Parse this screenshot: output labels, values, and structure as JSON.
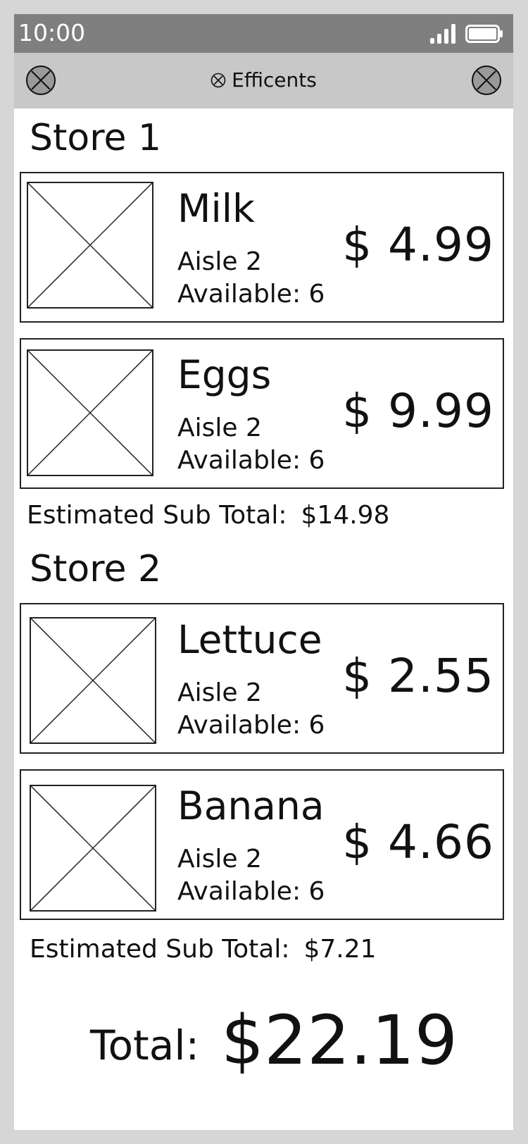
{
  "status_bar": {
    "time": "10:00",
    "signal_icon": "cellular-signal-icon",
    "battery_icon": "battery-full-icon"
  },
  "app_bar": {
    "left_icon": "close-circle-icon",
    "title_icon": "close-circle-icon",
    "title": "Efficents",
    "right_icon": "close-circle-icon"
  },
  "stores": [
    {
      "name": "Store 1",
      "items": [
        {
          "name": "Milk",
          "aisle": "Aisle 2",
          "available": "Available: 6",
          "price": "$ 4.99",
          "image_icon": "image-placeholder-icon"
        },
        {
          "name": "Eggs",
          "aisle": "Aisle 2",
          "available": "Available: 6",
          "price": "$ 9.99",
          "image_icon": "image-placeholder-icon"
        }
      ],
      "subtotal_label": "Estimated Sub Total:",
      "subtotal_value": "$14.98"
    },
    {
      "name": "Store 2",
      "items": [
        {
          "name": "Lettuce",
          "aisle": "Aisle 2",
          "available": "Available: 6",
          "price": "$ 2.55",
          "image_icon": "image-placeholder-icon"
        },
        {
          "name": "Banana",
          "aisle": "Aisle 2",
          "available": "Available: 6",
          "price": "$ 4.66",
          "image_icon": "image-placeholder-icon"
        }
      ],
      "subtotal_label": "Estimated Sub Total:",
      "subtotal_value": "$7.21"
    }
  ],
  "total": {
    "label": "Total:",
    "value": "$22.19"
  },
  "colors": {
    "page_background": "#d6d6d6",
    "status_bar": "#7f7f7f",
    "app_bar": "#c8c8c8",
    "content_background": "#ffffff",
    "text": "#111111"
  }
}
